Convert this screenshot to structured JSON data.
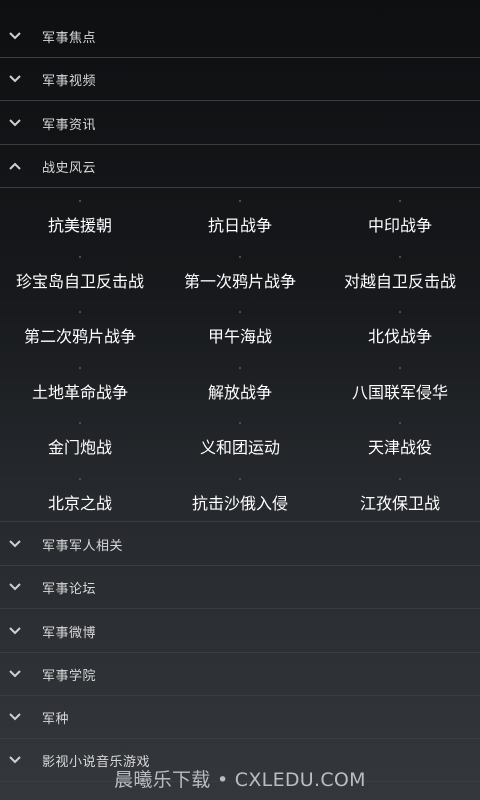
{
  "sections_top": [
    {
      "label": "军事焦点",
      "icon": "chevron-down-icon"
    },
    {
      "label": "军事视频",
      "icon": "chevron-down-icon"
    },
    {
      "label": "军事资讯",
      "icon": "chevron-down-icon"
    },
    {
      "label": "战史风云",
      "icon": "chevron-up-icon"
    }
  ],
  "battles": [
    "抗美援朝",
    "抗日战争",
    "中印战争",
    "珍宝岛自卫反击战",
    "第一次鸦片战争",
    "对越自卫反击战",
    "第二次鸦片战争",
    "甲午海战",
    "北伐战争",
    "土地革命战争",
    "解放战争",
    "八国联军侵华",
    "金门炮战",
    "义和团运动",
    "天津战役",
    "北京之战",
    "抗击沙俄入侵",
    "江孜保卫战"
  ],
  "sections_bottom": [
    {
      "label": "军事军人相关",
      "icon": "chevron-down-icon"
    },
    {
      "label": "军事论坛",
      "icon": "chevron-down-icon"
    },
    {
      "label": "军事微博",
      "icon": "chevron-down-icon"
    },
    {
      "label": "军事学院",
      "icon": "chevron-down-icon"
    },
    {
      "label": "军种",
      "icon": "chevron-down-icon"
    },
    {
      "label": "影视小说音乐游戏",
      "icon": "chevron-down-icon"
    }
  ],
  "watermark": "晨曦乐下载 • CXLEDU.COM",
  "colors": {
    "text": "#ffffff",
    "label": "#d8d8d8",
    "divider": "#3a3d42"
  }
}
